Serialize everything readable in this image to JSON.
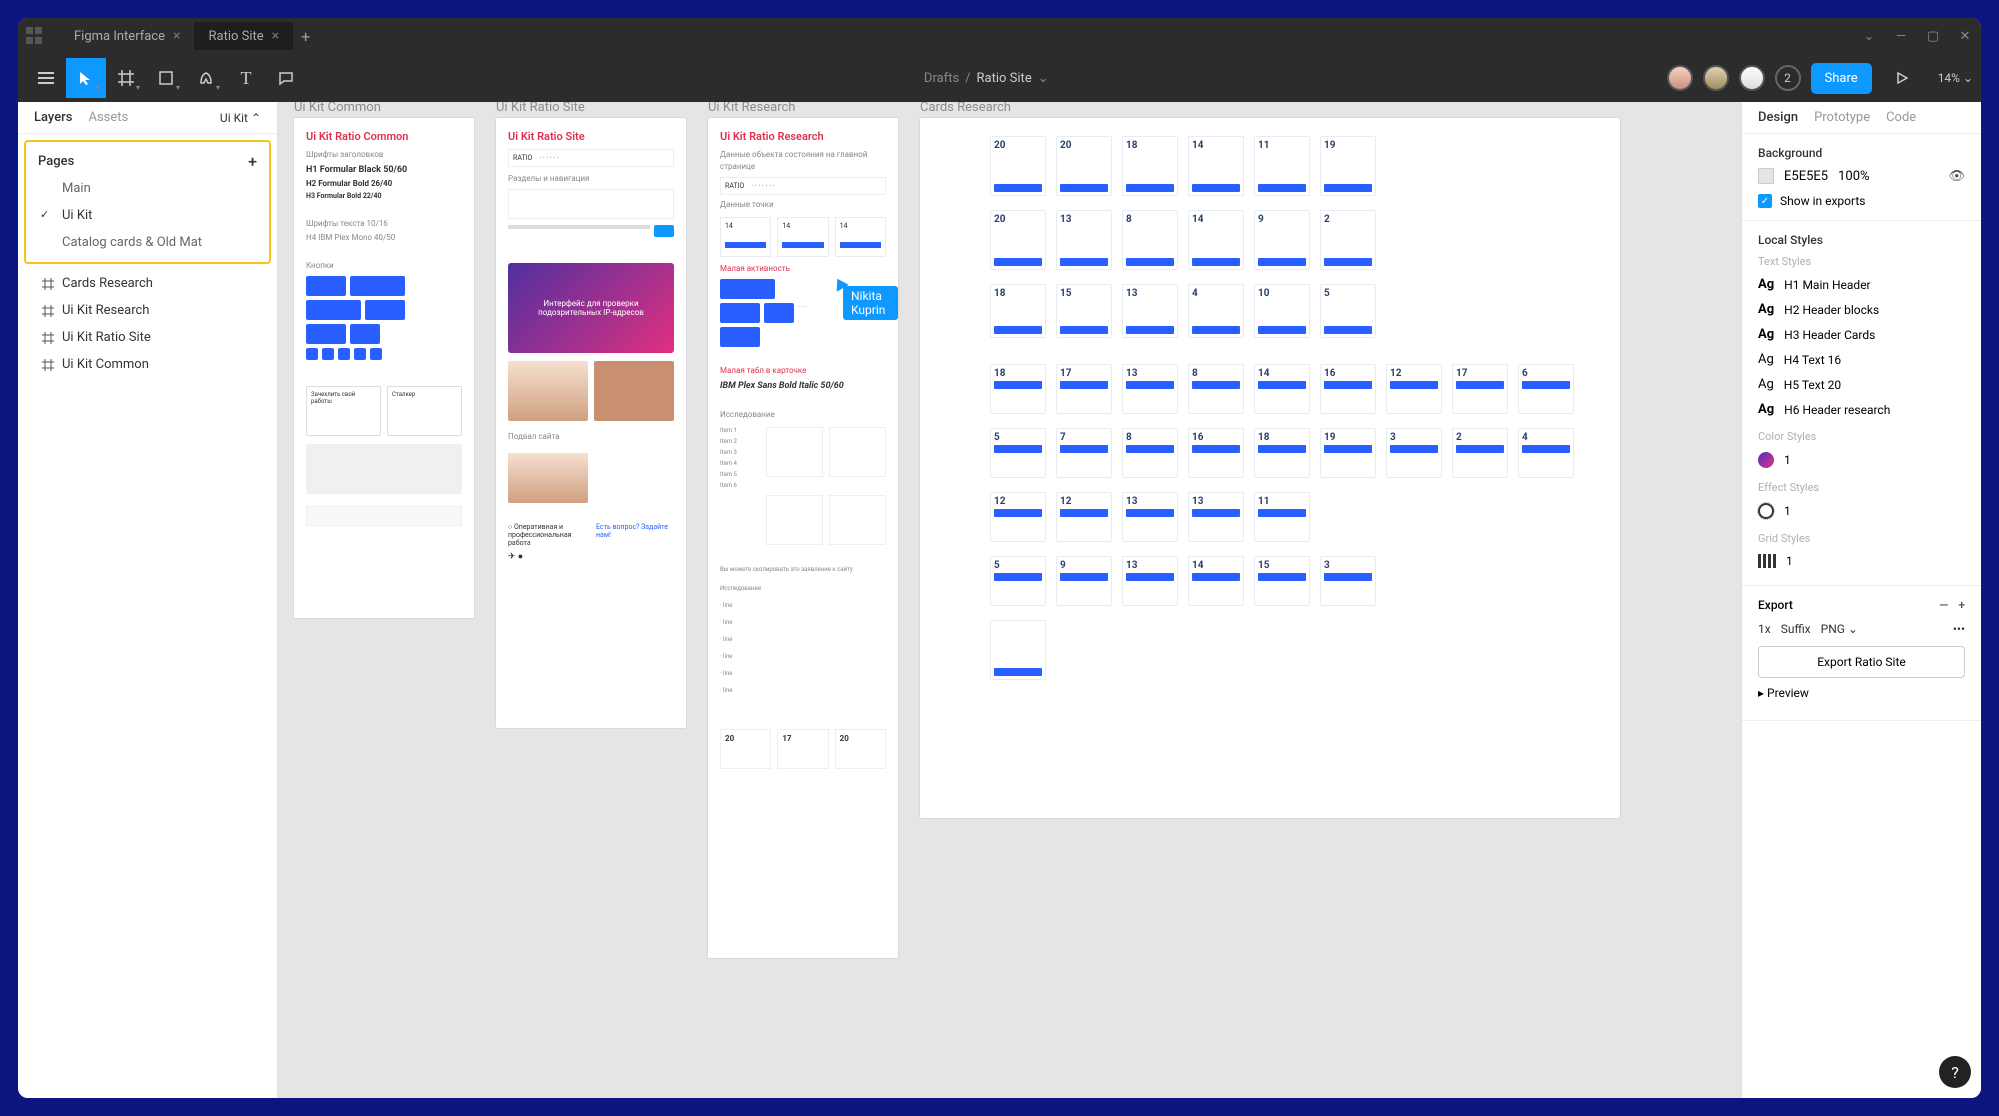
{
  "titlebar": {
    "tab1": "Figma Interface",
    "tab2": "Ratio Site"
  },
  "toolbar": {
    "path_root": "Drafts",
    "path_current": "Ratio Site",
    "user_count": "2",
    "share": "Share",
    "zoom": "14%"
  },
  "left": {
    "tab_layers": "Layers",
    "tab_assets": "Assets",
    "current_page": "Ui Kit",
    "pages_label": "Pages",
    "pages": [
      "Main",
      "Ui Kit",
      "Catalog cards & Old Mat"
    ],
    "frames": [
      "Cards Research",
      "Ui Kit Research",
      "Ui Kit Ratio Site",
      "Ui Kit Common"
    ]
  },
  "canvas": {
    "board1": {
      "label": "Ui Kit Common",
      "title": "Ui Kit Ratio Common",
      "h1": "H1 Formular Black 50/60",
      "h2": "H2 Formular Bold 26/40",
      "h3": "H3 Formular Bold 22/40"
    },
    "board2": {
      "label": "Ui Kit Ratio Site",
      "title": "Ui Kit Ratio Site",
      "banner": "Интерфейс для проверки подозрительных IP-адресов"
    },
    "board3": {
      "label": "Ui Kit Research",
      "title": "Ui Kit Ratio Research",
      "font": "IBM Plex Sans Bold Italic 50/60"
    },
    "board4": {
      "label": "Cards Research"
    },
    "cursor_user": "Nikita Kuprin"
  },
  "right": {
    "tab_design": "Design",
    "tab_proto": "Prototype",
    "tab_code": "Code",
    "bg_label": "Background",
    "bg_hex": "E5E5E5",
    "bg_pct": "100%",
    "show_exports": "Show in exports",
    "local_styles": "Local Styles",
    "text_styles_label": "Text Styles",
    "text_styles": [
      "H1 Main Header",
      "H2 Header blocks",
      "H3 Header Cards",
      "H4 Text 16",
      "H5 Text 20",
      "H6 Header research"
    ],
    "color_styles_label": "Color Styles",
    "color_name": "1",
    "effect_styles_label": "Effect Styles",
    "effect_name": "1",
    "grid_styles_label": "Grid Styles",
    "grid_name": "1",
    "export_label": "Export",
    "export_scale": "1x",
    "export_suffix_label": "Suffix",
    "export_format": "PNG",
    "export_btn": "Export Ratio Site",
    "preview": "Preview"
  }
}
